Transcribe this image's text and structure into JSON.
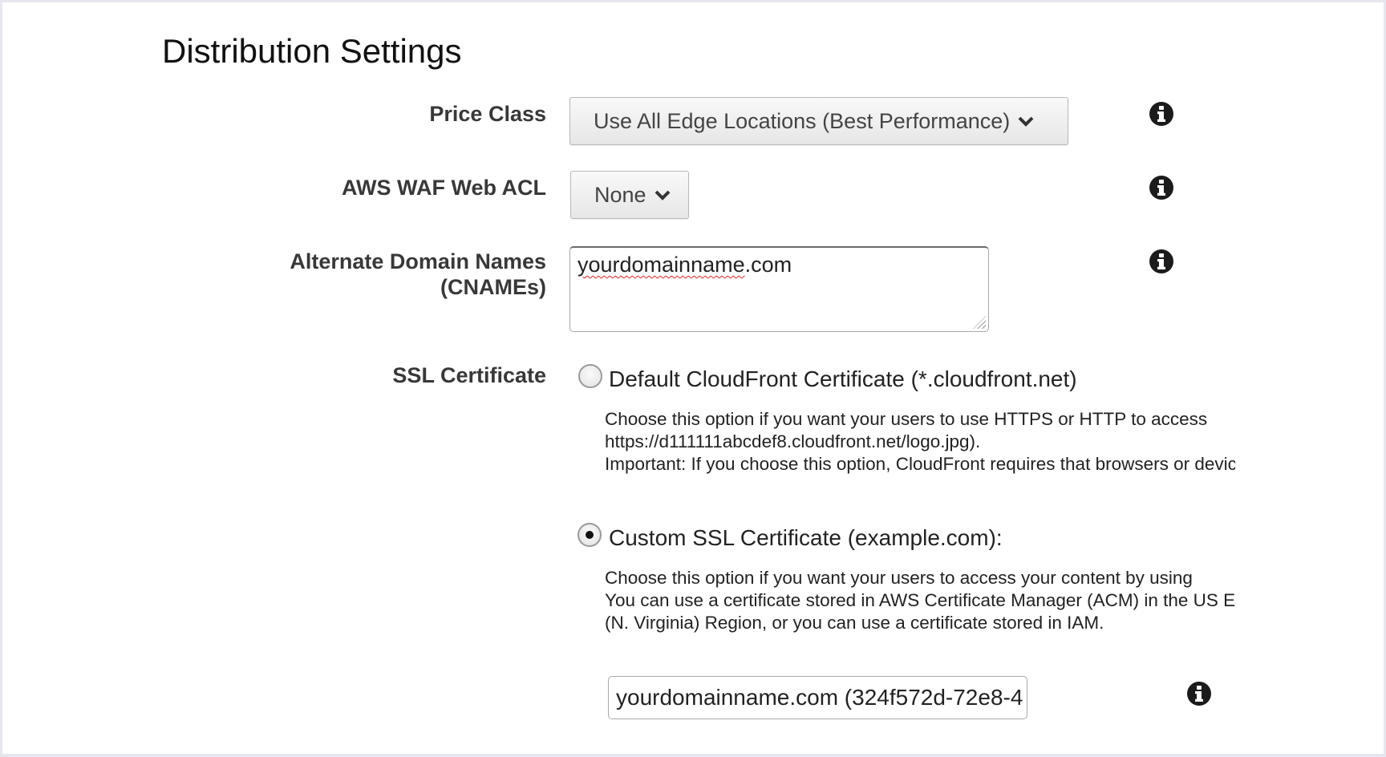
{
  "section_title": "Distribution Settings",
  "fields": {
    "price_class": {
      "label": "Price Class",
      "value": "Use All Edge Locations (Best Performance)"
    },
    "waf": {
      "label": "AWS WAF Web ACL",
      "value": "None"
    },
    "cnames": {
      "label_line1": "Alternate Domain Names",
      "label_line2": "(CNAMEs)",
      "value_misspelled": "yourdomainname",
      "value_rest": ".com"
    },
    "ssl": {
      "label": "SSL Certificate",
      "options": [
        {
          "label": "Default CloudFront Certificate (*.cloudfront.net)",
          "selected": false,
          "description": [
            "Choose this option if you want your users to use HTTPS or HTTP to access",
            "https://d111111abcdef8.cloudfront.net/logo.jpg).",
            "Important: If you choose this option, CloudFront requires that browsers or devices"
          ]
        },
        {
          "label": "Custom SSL Certificate (example.com):",
          "selected": true,
          "description": [
            "Choose this option if you want your users to access your content by using",
            "You can use a certificate stored in AWS Certificate Manager (ACM) in the US East",
            "(N. Virginia) Region, or you can use a certificate stored in IAM."
          ]
        }
      ],
      "certificate_value": "yourdomainname.com (324f572d-72e8-4"
    }
  },
  "icons": {
    "info": "info-icon",
    "chevron": "chevron-down-icon"
  }
}
